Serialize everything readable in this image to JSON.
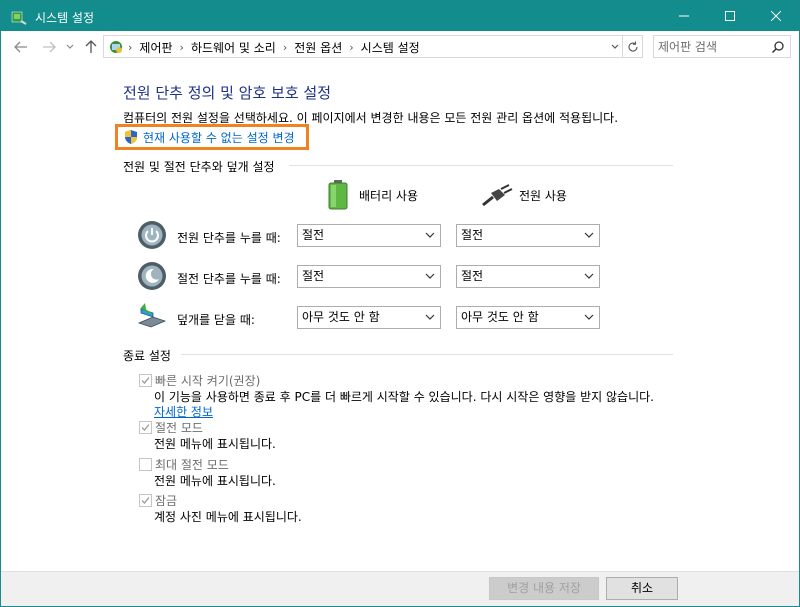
{
  "window": {
    "title": "시스템 설정"
  },
  "address": {
    "breadcrumbs": [
      "제어판",
      "하드웨어 및 소리",
      "전원 옵션",
      "시스템 설정"
    ],
    "search_placeholder": "제어판 검색"
  },
  "page": {
    "title": "전원 단추 정의 및 암호 보호 설정",
    "description": "컴퓨터의 전원 설정을 선택하세요. 이 페이지에서 변경한 내용은 모든 전원 관리 옵션에 적용됩니다.",
    "uac_link": "현재 사용할 수 없는 설정 변경"
  },
  "power_section": {
    "heading": "전원 및 절전 단추와 덮개 설정",
    "col_battery": "배터리 사용",
    "col_plugged": "전원 사용",
    "rows": [
      {
        "label": "전원 단추를 누를 때:",
        "battery": "절전",
        "plugged": "절전",
        "icon": "power-button-icon"
      },
      {
        "label": "절전 단추를 누를 때:",
        "battery": "절전",
        "plugged": "절전",
        "icon": "sleep-button-icon"
      },
      {
        "label": "덮개를 닫을 때:",
        "battery": "아무 것도 안 함",
        "plugged": "아무 것도 안 함",
        "icon": "laptop-lid-icon"
      }
    ]
  },
  "shutdown_section": {
    "heading": "종료 설정",
    "options": [
      {
        "label": "빠른 시작 켜기(권장)",
        "checked": true,
        "desc": "이 기능을 사용하면 종료 후 PC를 더 빠르게 시작할 수 있습니다. 다시 시작은 영향을 받지 않습니다.",
        "link": "자세한 정보"
      },
      {
        "label": "절전 모드",
        "checked": true,
        "desc": "전원 메뉴에 표시됩니다."
      },
      {
        "label": "최대 절전 모드",
        "checked": false,
        "desc": "전원 메뉴에 표시됩니다."
      },
      {
        "label": "잠금",
        "checked": true,
        "desc": "계정 사진 메뉴에 표시됩니다."
      }
    ]
  },
  "footer": {
    "save": "변경 내용 저장",
    "cancel": "취소"
  },
  "colors": {
    "titlebar": "#128c8c",
    "link": "#0066cc",
    "highlight": "#f08224",
    "title": "#1e3287"
  }
}
